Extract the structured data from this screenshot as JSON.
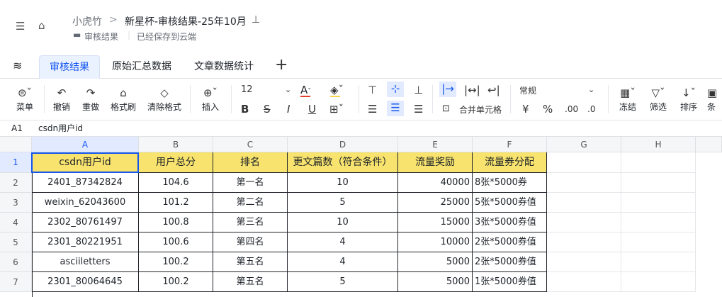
{
  "header": {
    "breadcrumb_root": "小虎竹",
    "breadcrumb_sep": ">",
    "doc_title": "新星杯-审核结果-25年10月",
    "folder": "审核结果",
    "save_status": "已经保存到云端"
  },
  "tabs": [
    "审核结果",
    "原始汇总数据",
    "文章数据统计"
  ],
  "add_tab": "+",
  "toolbar": {
    "menu": "菜单",
    "undo": "撤销",
    "redo": "重做",
    "format_painter": "格式刷",
    "clear_format": "清除格式",
    "insert": "插入",
    "font_size": "12",
    "merge": "合并单元格",
    "number_format": "常规",
    "currency": "¥",
    "percent": "%",
    "dec_inc": ".00",
    "dec_dec": ".0",
    "freeze": "冻结",
    "filter": "筛选",
    "sort": "排序",
    "cond": "条件",
    "bold": "B",
    "strike": "S",
    "italic": "I",
    "underline": "U",
    "font_color": "A"
  },
  "formula_bar": {
    "ref": "A1",
    "content": "csdn用户id"
  },
  "columns": [
    "A",
    "B",
    "C",
    "D",
    "E",
    "F",
    "G",
    "H"
  ],
  "rows": [
    "1",
    "2",
    "3",
    "4",
    "5",
    "6",
    "7"
  ],
  "table": {
    "headers": [
      "csdn用户id",
      "用户总分",
      "排名",
      "更文篇数（符合条件）",
      "流量奖励",
      "流量券分配"
    ],
    "data": [
      [
        "2401_87342824",
        "104.6",
        "第一名",
        "10",
        "40000",
        "8张*5000券"
      ],
      [
        "weixin_62043600",
        "101.2",
        "第二名",
        "5",
        "25000",
        "5张*5000券值"
      ],
      [
        "2302_80761497",
        "100.8",
        "第三名",
        "10",
        "15000",
        "3张*5000券值"
      ],
      [
        "2301_80221951",
        "100.6",
        "第四名",
        "4",
        "10000",
        "2张*5000券值"
      ],
      [
        "asciiletters",
        "100.2",
        "第五名",
        "4",
        "5000",
        "2张*5000券值"
      ],
      [
        "2301_80064645",
        "100.2",
        "第五名",
        "5",
        "5000",
        "1张*5000券值"
      ]
    ]
  },
  "colors": {
    "header_fill": "#f7e36d",
    "accent": "#1456f0"
  }
}
